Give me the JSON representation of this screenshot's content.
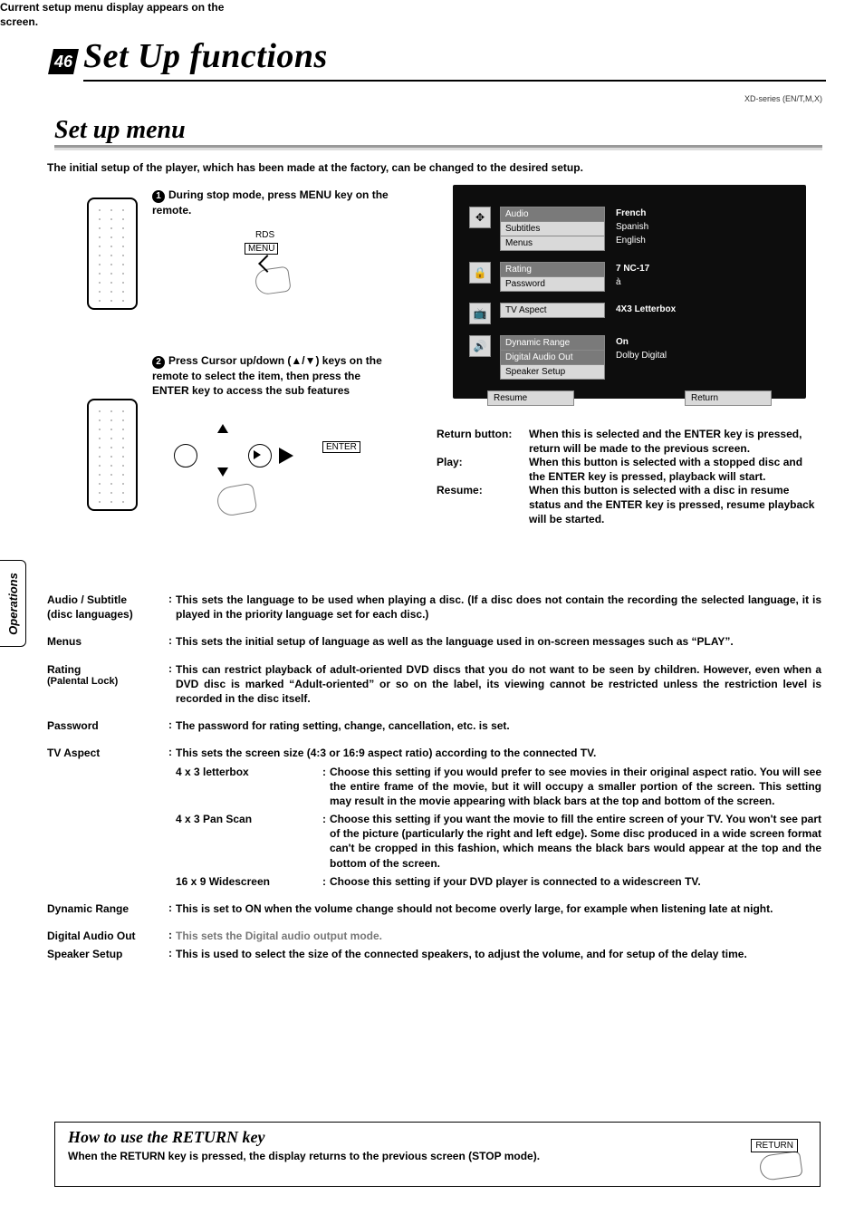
{
  "header": {
    "page_number": "46",
    "title": "Set Up functions",
    "doc_id": "XD-series (EN/T,M,X)",
    "section": "Set up menu",
    "intro": "The initial setup of the player, which has been made at the factory, can be changed to the desired setup."
  },
  "side_tab": "Operations",
  "steps": {
    "s1_num": "1",
    "s1_text": "During stop mode, press MENU key on the remote.",
    "rds": "RDS",
    "menu": "MENU",
    "s1b": "Current setup menu display appears on the screen.",
    "s2_num": "2",
    "s2_text": "Press Cursor up/down (▲/▼) keys on the remote to select the item, then press the ENTER key to access the sub features",
    "enter": "ENTER"
  },
  "osd": {
    "g1_icon": "✥",
    "g1": {
      "a": "Audio",
      "b": "Subtitles",
      "c": "Menus"
    },
    "r1": {
      "a": "French",
      "b": "Spanish",
      "c": "English"
    },
    "g2_icon": "🔒",
    "g2": {
      "a": "Rating",
      "b": "Password"
    },
    "r2": {
      "a": "7 NC-17",
      "b": "à"
    },
    "g3_icon": "📺",
    "g3": {
      "a": "TV Aspect"
    },
    "r3": {
      "a": "4X3 Letterbox"
    },
    "g4_icon": "🔊",
    "g4": {
      "a": "Dynamic Range",
      "b": "Digital Audio Out",
      "c": "Speaker Setup"
    },
    "r4": {
      "a": "On",
      "b": "Dolby Digital"
    },
    "btn_resume": "Resume",
    "btn_return": "Return"
  },
  "buttons_desc": {
    "return_k": "Return button:",
    "return_v": "When this is selected and the ENTER key is pressed, return will be made to the previous screen.",
    "play_k": "Play:",
    "play_v": "When this button is selected with a stopped disc and the ENTER key is pressed, playback will start.",
    "resume_k": "Resume:",
    "resume_v": "When this button is selected with a disc in resume status and the ENTER key is pressed, resume playback will be started."
  },
  "settings": {
    "audio_k": "Audio / Subtitle",
    "audio_k2": "(disc languages)",
    "audio_v": "This sets the language to be used when playing a disc. (If a disc does not contain the recording the selected language, it is played in the priority language set for each disc.)",
    "menus_k": "Menus",
    "menus_v": "This sets the initial setup of language as well as the language used in on-screen messages such as “PLAY”.",
    "rating_k": "Rating",
    "rating_k2": "(Palental Lock)",
    "rating_v": "This can restrict playback of adult-oriented DVD discs that you do not want to be seen by children. However, even when a DVD disc is marked “Adult-oriented” or so on the label, its viewing cannot be restricted unless the restriction level is recorded in the disc itself.",
    "password_k": "Password",
    "password_v": "The password for rating setting, change, cancellation, etc. is set.",
    "tv_k": "TV Aspect",
    "tv_v": "This sets the screen size (4:3 or 16:9 aspect ratio) according to the connected TV.",
    "tv_lb_k": "4 x 3 letterbox",
    "tv_lb_v": "Choose this setting if you would prefer to see movies in their original aspect ratio. You will see the entire frame of the movie, but it will occupy a smaller portion of the screen. This setting may result in the movie appearing with black bars at the top and bottom of the screen.",
    "tv_ps_k": "4 x 3 Pan Scan",
    "tv_ps_v": "Choose this setting if you want the movie to fill the entire screen of your TV. You won't see part of the picture (particularly the right and left edge). Some disc produced in a wide screen format can't be cropped in this fashion, which means the black bars would appear at the top and the bottom of the screen.",
    "tv_ws_k": "16 x 9 Widescreen",
    "tv_ws_v": "Choose this setting if your DVD player is connected to a widescreen TV.",
    "dr_k": "Dynamic Range",
    "dr_v": "This is set to ON when the volume change should not become overly large, for example when listening late at night.",
    "dao_k": "Digital Audio Out",
    "dao_v": "This sets the Digital audio output mode.",
    "sp_k": "Speaker Setup",
    "sp_v": "This is used to select the size of the connected speakers, to adjust the volume, and for setup of the delay time."
  },
  "return_box": {
    "title": "How to use the RETURN key",
    "body": "When the RETURN key is pressed, the display returns to the previous screen (STOP mode).",
    "btn": "RETURN"
  }
}
